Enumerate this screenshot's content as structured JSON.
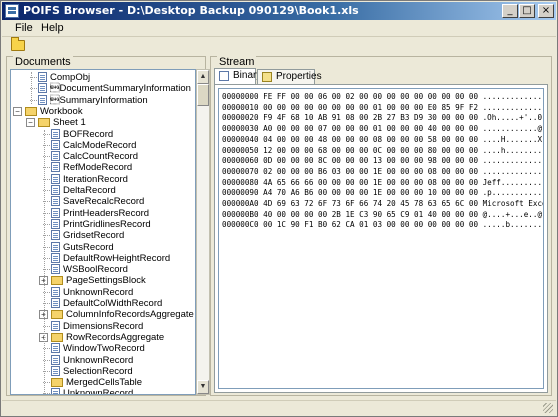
{
  "window": {
    "title": "POIFS Browser - D:\\Desktop Backup 090129\\Book1.xls"
  },
  "titlebar_buttons": {
    "minimize": "_",
    "maximize": "□",
    "close": "×"
  },
  "menu": {
    "file": "File",
    "help": "Help"
  },
  "documents": {
    "label": "Documents",
    "tree": [
      {
        "label": "CompObj",
        "icon": "document-icon",
        "depth": 1
      },
      {
        "label": "\u0005DocumentSummaryInformation",
        "icon": "document-icon",
        "depth": 1
      },
      {
        "label": "\u0005SummaryInformation",
        "icon": "document-icon",
        "depth": 1
      },
      {
        "label": "Workbook",
        "icon": "folder-icon",
        "depth": 0,
        "expander": "-"
      },
      {
        "label": "Sheet 1",
        "icon": "folder-icon",
        "depth": 1,
        "expander": "-"
      },
      {
        "label": "BOFRecord",
        "icon": "document-icon",
        "depth": 2
      },
      {
        "label": "CalcModeRecord",
        "icon": "document-icon",
        "depth": 2
      },
      {
        "label": "CalcCountRecord",
        "icon": "document-icon",
        "depth": 2
      },
      {
        "label": "RefModeRecord",
        "icon": "document-icon",
        "depth": 2
      },
      {
        "label": "IterationRecord",
        "icon": "document-icon",
        "depth": 2
      },
      {
        "label": "DeltaRecord",
        "icon": "document-icon",
        "depth": 2
      },
      {
        "label": "SaveRecalcRecord",
        "icon": "document-icon",
        "depth": 2
      },
      {
        "label": "PrintHeadersRecord",
        "icon": "document-icon",
        "depth": 2
      },
      {
        "label": "PrintGridlinesRecord",
        "icon": "document-icon",
        "depth": 2
      },
      {
        "label": "GridsetRecord",
        "icon": "document-icon",
        "depth": 2
      },
      {
        "label": "GutsRecord",
        "icon": "document-icon",
        "depth": 2
      },
      {
        "label": "DefaultRowHeightRecord",
        "icon": "document-icon",
        "depth": 2
      },
      {
        "label": "WSBoolRecord",
        "icon": "document-icon",
        "depth": 2
      },
      {
        "label": "PageSettingsBlock",
        "icon": "folder-icon",
        "depth": 2,
        "expander": "+"
      },
      {
        "label": "UnknownRecord",
        "icon": "document-icon",
        "depth": 2
      },
      {
        "label": "DefaultColWidthRecord",
        "icon": "document-icon",
        "depth": 2
      },
      {
        "label": "ColumnInfoRecordsAggregate",
        "icon": "folder-icon",
        "depth": 2,
        "expander": "+"
      },
      {
        "label": "DimensionsRecord",
        "icon": "document-icon",
        "depth": 2
      },
      {
        "label": "RowRecordsAggregate",
        "icon": "folder-icon",
        "depth": 2,
        "expander": "+"
      },
      {
        "label": "WindowTwoRecord",
        "icon": "document-icon",
        "depth": 2
      },
      {
        "label": "UnknownRecord",
        "icon": "document-icon",
        "depth": 2
      },
      {
        "label": "SelectionRecord",
        "icon": "document-icon",
        "depth": 2
      },
      {
        "label": "MergedCellsTable",
        "icon": "folder-icon",
        "depth": 2
      },
      {
        "label": "UnknownRecord",
        "icon": "document-icon",
        "depth": 2
      }
    ]
  },
  "stream": {
    "label": "Stream",
    "tabs": [
      {
        "label": "Binary",
        "active": true
      },
      {
        "label": "Properties",
        "active": false
      }
    ],
    "hex_lines": [
      "00000000 FE FF 00 00 06 00 02 00 00 00 00 00 00 00 00 00 ................",
      "00000010 00 00 00 00 00 00 00 00 01 00 00 00 E0 85 9F F2 ................",
      "00000020 F9 4F 68 10 AB 91 08 00 2B 27 B3 D9 30 00 00 00 .Oh.....+'..0...",
      "00000030 A0 00 00 00 07 00 00 00 01 00 00 00 40 00 00 00 ............@...",
      "00000040 04 00 00 00 48 00 00 00 08 00 00 00 58 00 00 00 ....H.......X...",
      "00000050 12 00 00 00 68 00 00 00 0C 00 00 00 80 00 00 00 ....h...........",
      "00000060 0D 00 00 00 8C 00 00 00 13 00 00 00 98 00 00 00 ................",
      "00000070 02 00 00 00 B6 03 00 00 1E 00 00 00 08 00 00 00 ................",
      "00000080 4A 65 66 66 00 00 00 00 1E 00 00 00 08 00 00 00 Jeff............",
      "00000090 A4 70 A6 B6 00 00 00 00 1E 00 00 00 10 00 00 00 .p..............",
      "000000A0 4D 69 63 72 6F 73 6F 66 74 20 45 78 63 65 6C 00 Microsoft Excel.",
      "000000B0 40 00 00 00 00 2B 1E C3 90 65 C9 01 40 00 00 00 @....+...e..@...",
      "000000C0 00 1C 90 F1 B0 62 CA 01 03 00 00 00 00 00 00 00 .....b.........."
    ]
  }
}
